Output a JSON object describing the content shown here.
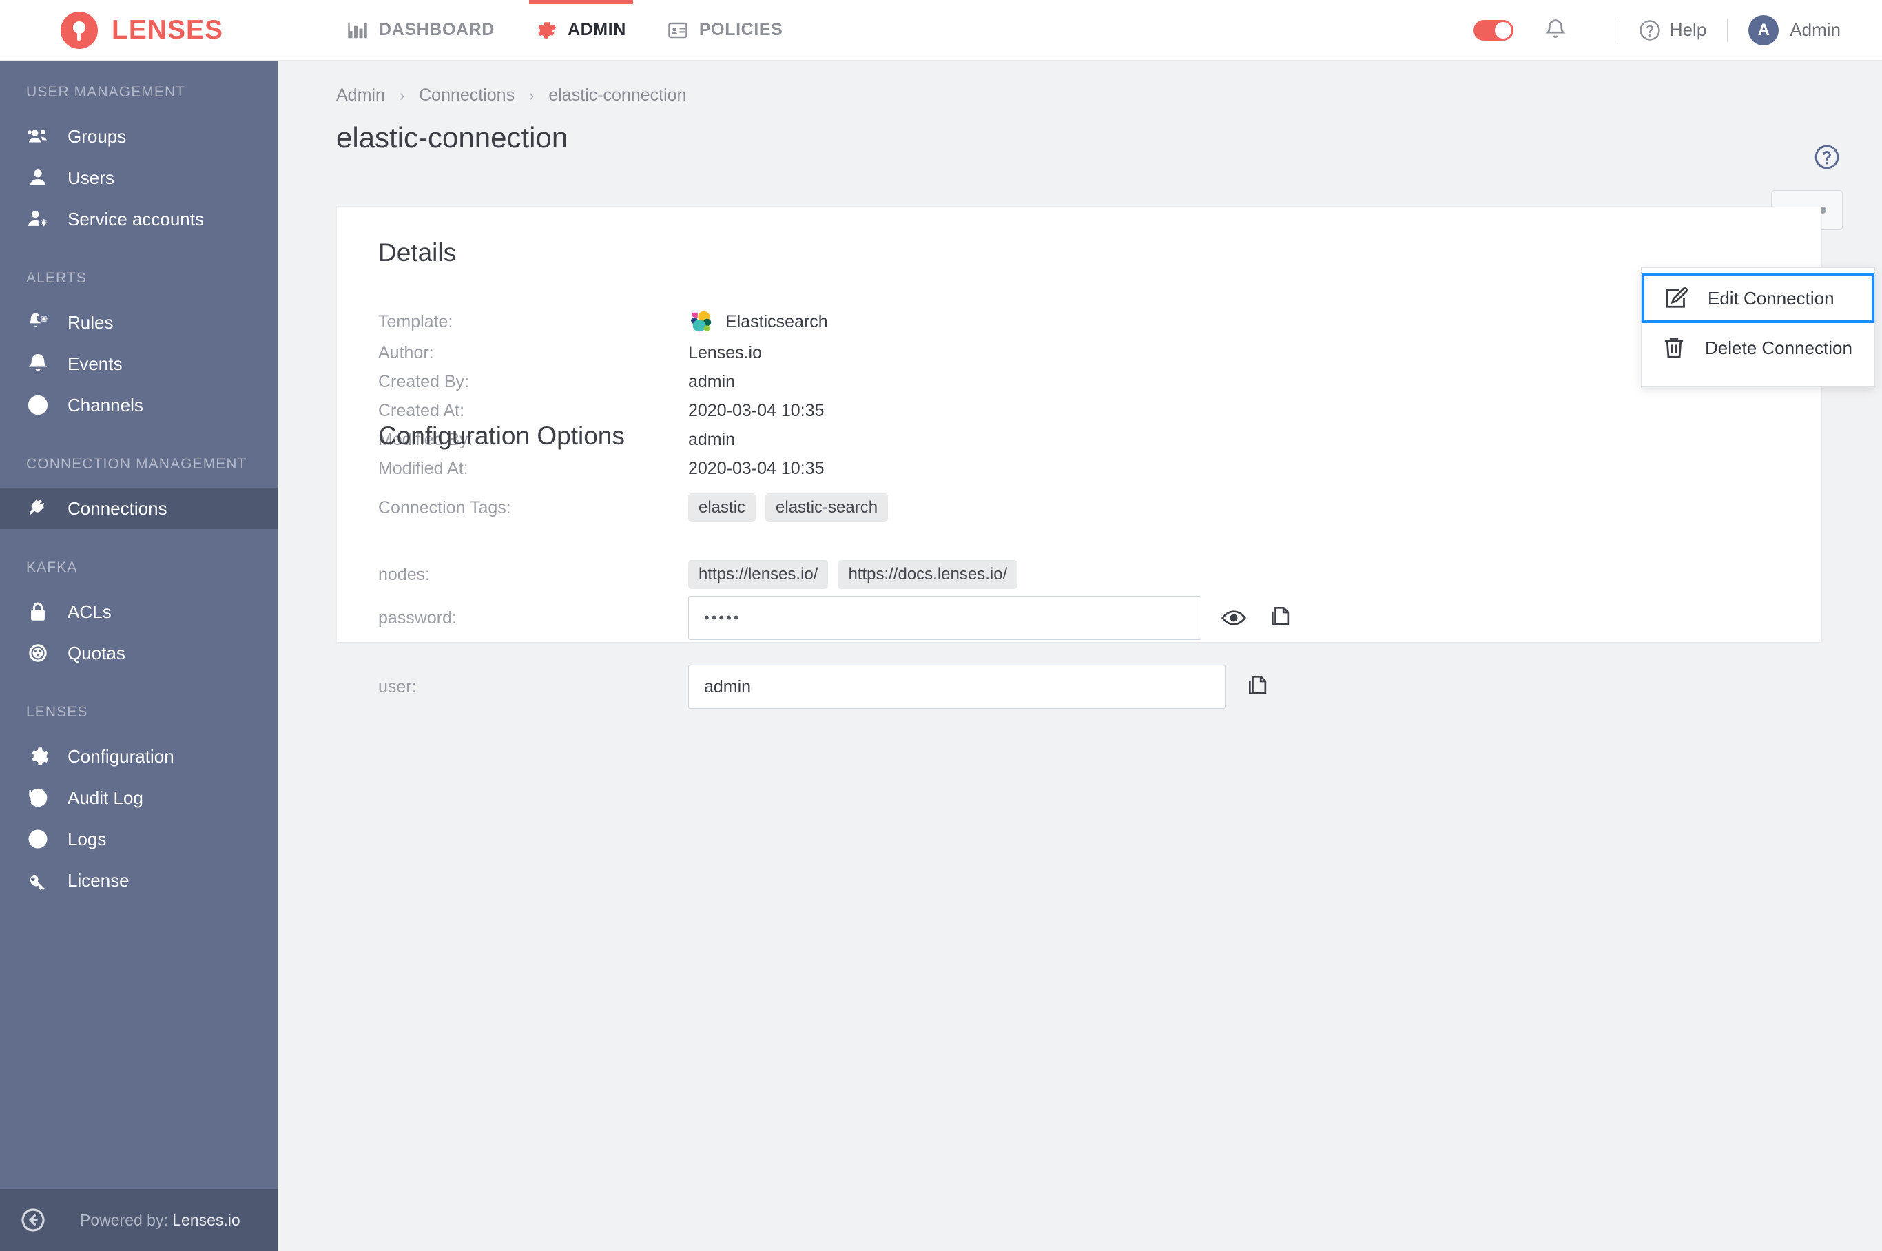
{
  "header": {
    "brand": "LENSES",
    "nav": [
      {
        "label": "DASHBOARD",
        "icon": "chart-bar-icon",
        "active": false
      },
      {
        "label": "ADMIN",
        "icon": "gear-icon",
        "active": true
      },
      {
        "label": "POLICIES",
        "icon": "id-card-icon",
        "active": false
      }
    ],
    "help_label": "Help",
    "user_label": "Admin",
    "user_initial": "A",
    "accent_color": "#f1615c"
  },
  "sidebar": {
    "sections": [
      {
        "title": "USER MANAGEMENT",
        "items": [
          {
            "label": "Groups",
            "icon": "users-group-icon",
            "active": false
          },
          {
            "label": "Users",
            "icon": "user-icon",
            "active": false
          },
          {
            "label": "Service accounts",
            "icon": "user-gear-icon",
            "active": false
          }
        ]
      },
      {
        "title": "ALERTS",
        "items": [
          {
            "label": "Rules",
            "icon": "bell-gear-icon",
            "active": false
          },
          {
            "label": "Events",
            "icon": "bell-icon",
            "active": false
          },
          {
            "label": "Channels",
            "icon": "channels-icon",
            "active": false
          }
        ]
      },
      {
        "title": "CONNECTION MANAGEMENT",
        "items": [
          {
            "label": "Connections",
            "icon": "plug-icon",
            "active": true
          }
        ]
      },
      {
        "title": "KAFKA",
        "items": [
          {
            "label": "ACLs",
            "icon": "lock-icon",
            "active": false
          },
          {
            "label": "Quotas",
            "icon": "gauge-icon",
            "active": false
          }
        ]
      },
      {
        "title": "LENSES",
        "items": [
          {
            "label": "Configuration",
            "icon": "gear-icon",
            "active": false
          },
          {
            "label": "Audit Log",
            "icon": "history-icon",
            "active": false
          },
          {
            "label": "Logs",
            "icon": "clock-icon",
            "active": false
          },
          {
            "label": "License",
            "icon": "key-icon",
            "active": false
          }
        ]
      }
    ],
    "footer": {
      "collapse_icon": "arrow-circle-left-icon",
      "powered_prefix": "Powered by: ",
      "powered_brand": "Lenses.io"
    }
  },
  "main": {
    "breadcrumb": [
      "Admin",
      "Connections",
      "elastic-connection"
    ],
    "breadcrumb_separator": "›",
    "page_title": "elastic-connection",
    "kebab_button_label": "•••",
    "help_icon": "question-circle-icon"
  },
  "dropdown": {
    "items": [
      {
        "label": "Edit Connection",
        "icon": "edit-pencil-icon",
        "selected": true
      },
      {
        "label": "Delete Connection",
        "icon": "trash-icon",
        "selected": false
      }
    ],
    "selected_outline_color": "#1a8cff"
  },
  "details": {
    "section_title": "Details",
    "rows": [
      {
        "key": "Template:",
        "value": "Elasticsearch",
        "type": "logo",
        "logo": "elasticsearch-logo"
      },
      {
        "key": "Author:",
        "value": "Lenses.io",
        "type": "text"
      },
      {
        "key": "Created By:",
        "value": "admin",
        "type": "text"
      },
      {
        "key": "Created At:",
        "value": "2020-03-04 10:35",
        "type": "text"
      },
      {
        "key": "Modified By:",
        "value": "admin",
        "type": "text"
      },
      {
        "key": "Modified At:",
        "value": "2020-03-04 10:35",
        "type": "text"
      },
      {
        "key": "Connection Tags:",
        "type": "tags",
        "tags": [
          "elastic",
          "elastic-search"
        ]
      }
    ]
  },
  "configuration": {
    "section_title": "Configuration Options",
    "nodes": {
      "label": "nodes:",
      "values": [
        "https://lenses.io/",
        "https://docs.lenses.io/"
      ]
    },
    "password": {
      "label": "password:",
      "value": "•••••",
      "reveal_icon": "eye-icon",
      "copy_icon": "copy-icon"
    },
    "user": {
      "label": "user:",
      "value": "admin",
      "copy_icon": "copy-icon"
    }
  }
}
